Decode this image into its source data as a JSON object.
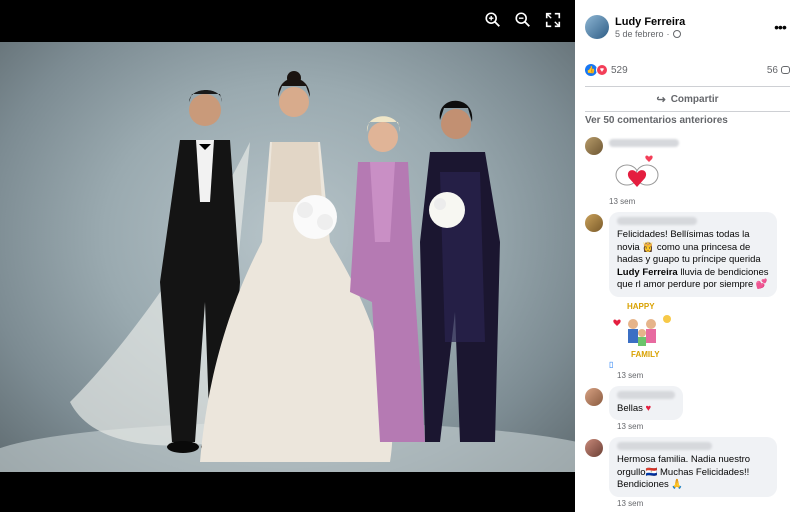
{
  "viewer": {
    "tools": [
      {
        "name": "zoom-in-icon"
      },
      {
        "name": "zoom-out-icon"
      },
      {
        "name": "fullscreen-icon"
      }
    ]
  },
  "post": {
    "author": "Ludy Ferreira",
    "date": "5 de febrero",
    "reaction_count": "529",
    "comment_count": "56",
    "share_label": "Compartir",
    "view_previous": "Ver 50 comentarios anteriores"
  },
  "comments": [
    {
      "time": "13 sem",
      "sticker": "hearts-bunnies-sticker"
    },
    {
      "text_before": "Felicidades! Bellísimas todas la novia ",
      "emoji1": "👸",
      "text_middle": " como una princesa de hadas y guapo tu príncipe querida ",
      "mention": "Ludy Ferreira",
      "text_after": " lluvia de bendiciones que rl amor perdure por siempre ",
      "emoji2": "💕",
      "time": "13 sem",
      "sticker": "happy-family-sticker"
    },
    {
      "text": "Bellas ",
      "emoji": "♥",
      "time": "13 sem"
    },
    {
      "text_before": "Hermosa familia. Nadia nuestro orgullo",
      "flag": "🇵🇾",
      "text_after": " Muchas Felicidades!! Bendiciones ",
      "emoji": "🙏",
      "time": "13 sem"
    }
  ],
  "colors": {
    "accent": "#1877f2",
    "love": "#f33e58",
    "text_secondary": "#65676b",
    "bubble": "#f0f2f5"
  }
}
